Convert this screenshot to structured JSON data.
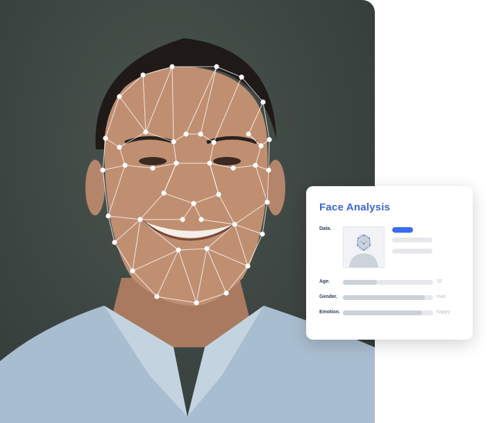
{
  "card": {
    "title": "Face Analysis",
    "data_label": "Data.",
    "rows": [
      {
        "label": "Age.",
        "value": "32",
        "fill_pct": 38
      },
      {
        "label": "Gender.",
        "value": "man",
        "fill_pct": 91
      },
      {
        "label": "Emotion.",
        "value": "happy",
        "fill_pct": 88
      }
    ]
  },
  "colors": {
    "accent": "#3e64d6",
    "accent_pill": "#3e6cf0",
    "photo_background": "#3c4541"
  }
}
